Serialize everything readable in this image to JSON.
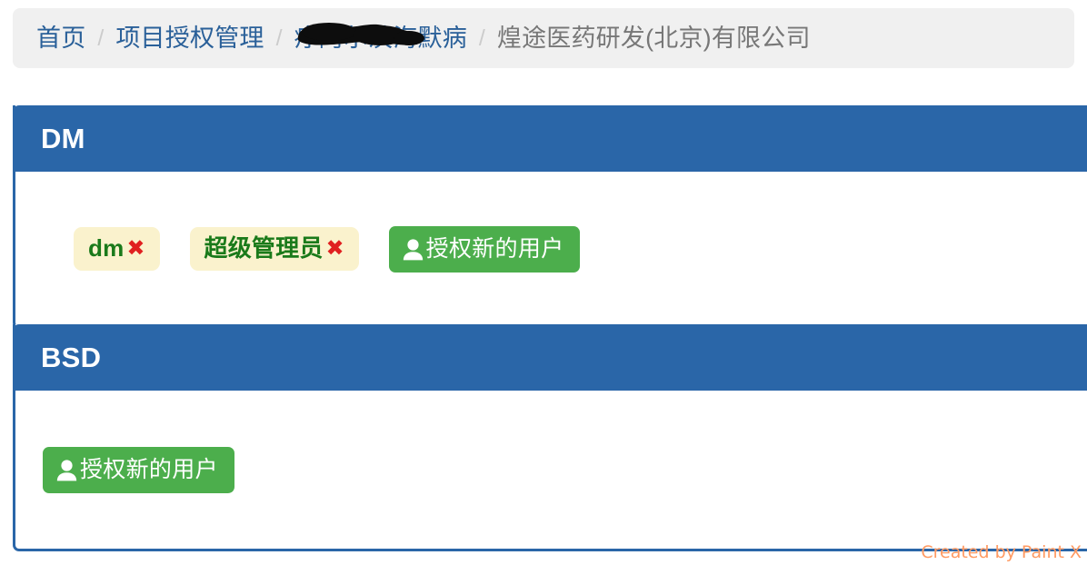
{
  "breadcrumb": {
    "items": [
      {
        "label": "首页",
        "active": false,
        "redacted": false
      },
      {
        "label": "项目授权管理",
        "active": false,
        "redacted": false
      },
      {
        "label": "疗阿尔茨海默病",
        "active": false,
        "redacted": true
      },
      {
        "label": "煌途医药研发(北京)有限公司",
        "active": true,
        "redacted": false
      }
    ],
    "separator": "/"
  },
  "panels": [
    {
      "title": "DM",
      "roles": [
        {
          "label": "dm",
          "remove_icon": "✖"
        },
        {
          "label": "超级管理员",
          "remove_icon": "✖"
        }
      ],
      "grant_button": {
        "label": "授权新的用户",
        "icon": "user-icon"
      }
    },
    {
      "title": "BSD",
      "roles": [],
      "grant_button": {
        "label": "授权新的用户",
        "icon": "user-icon"
      }
    }
  ],
  "watermark": {
    "text": "Created by Paint X"
  },
  "colors": {
    "panel_header": "#2a66a8",
    "panel_border": "#2a66a8",
    "breadcrumb_bg": "#f0f0f0",
    "breadcrumb_link": "#2a6099",
    "breadcrumb_active": "#777777",
    "badge_bg": "#faf2cd",
    "badge_text": "#1a7a1a",
    "badge_remove": "#e02020",
    "button_green": "#4cae4c",
    "watermark": "#ff9a62"
  }
}
